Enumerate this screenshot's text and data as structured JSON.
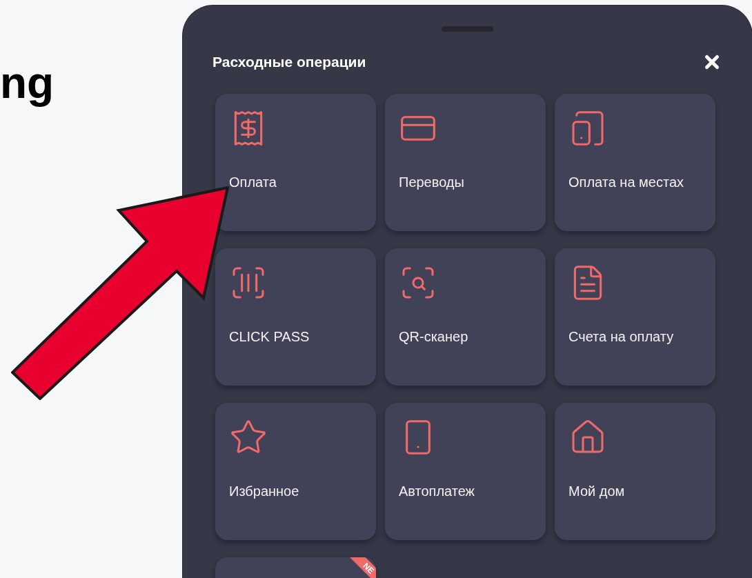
{
  "page_heading": "ng",
  "sheet": {
    "title": "Расходные операции",
    "tiles": [
      {
        "label": "Оплата"
      },
      {
        "label": "Переводы"
      },
      {
        "label": "Оплата на местах"
      },
      {
        "label": "CLICK PASS"
      },
      {
        "label": "QR-сканер"
      },
      {
        "label": "Счета на оплату"
      },
      {
        "label": "Избранное"
      },
      {
        "label": "Автоплатеж"
      },
      {
        "label": "Мой дом"
      },
      {
        "badge": "NE"
      }
    ]
  }
}
